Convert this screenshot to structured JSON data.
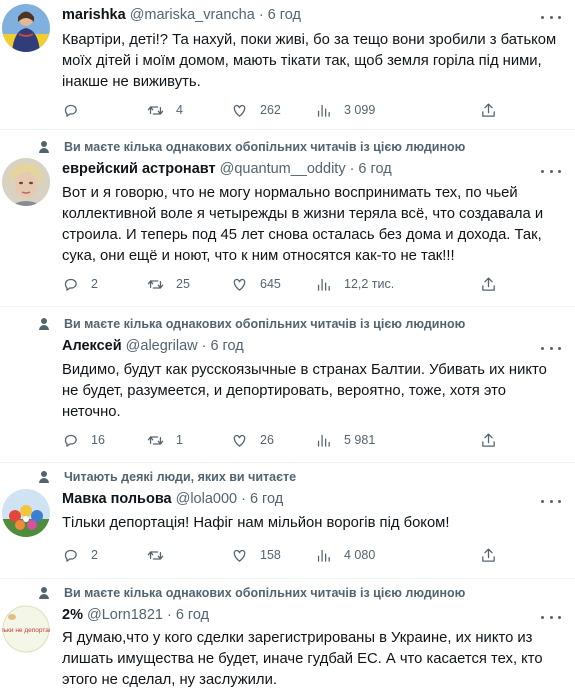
{
  "tweets": [
    {
      "social_context": "",
      "name": "marishka",
      "handle": "@mariska_vrancha",
      "dot": "·",
      "time": "6 год",
      "text": "Квартіри, деті!? Та нахуй, поки живі, бо за тещо вони зробили з батьком моїх дітей і моїм домом, мають тікати так, щоб земля горіла під ними, інакше не виживуть.",
      "replies": "",
      "retweets": "4",
      "likes": "262",
      "views": "3 099"
    },
    {
      "social_context": "Ви маєте кілька однакових обопільних читачів із цією людиною",
      "name": "еврейский астронавт",
      "handle": "@quantum__oddity",
      "dot": "·",
      "time": "6 год",
      "text": "Вот и я говорю, что не могу нормально воспринимать тех, по чьей коллективной воле я четырежды в жизни теряла всё, что создавала и строила. И теперь под 45 лет снова осталась без дома и дохода. Так, сука, они ещё и ноют, что к ним относятся как-то не так!!!",
      "replies": "2",
      "retweets": "25",
      "likes": "645",
      "views": "12,2 тис."
    },
    {
      "social_context": "Ви маєте кілька однакових обопільних читачів із цією людиною",
      "name": "Алексей",
      "handle": "@alegrilaw",
      "dot": "·",
      "time": "6 год",
      "text": "Видимо, будут как русскоязычные в странах Балтии. Убивать их никто не будет, разумеется, и депортировать, вероятно, тоже, хотя это неточно.",
      "replies": "16",
      "retweets": "1",
      "likes": "26",
      "views": "5 981"
    },
    {
      "social_context": "Читають деякі люди, яких ви читаєте",
      "name": "Мавка польова",
      "handle": "@lola000",
      "dot": "·",
      "time": "6 год",
      "text": "Тільки депортація! Нафіг нам мільйон ворогів під боком!",
      "replies": "2",
      "retweets": "",
      "likes": "158",
      "views": "4 080"
    },
    {
      "social_context": "Ви маєте кілька однакових обопільних читачів із цією людиною",
      "name": "2%",
      "handle": "@Lorn1821",
      "dot": "·",
      "time": "6 год",
      "text": "Я думаю,что у кого сделки зарегистрированы в Украине, их никто из лишать имущества не будет, иначе гудбай ЕС. А что касается тех, кто этого не сделал, ну заслужили.",
      "replies": "",
      "retweets": "",
      "likes": "",
      "views": ""
    }
  ],
  "avatars": {
    "t4_badge_text": "Тільки не депортація"
  },
  "icons": {
    "reply": "reply-icon",
    "retweet": "retweet-icon",
    "like": "like-icon",
    "views": "views-icon",
    "share": "share-icon",
    "more": "more-icon",
    "person": "person-icon"
  },
  "colors": {
    "text": "#0f1419",
    "secondary": "#536471",
    "divider": "#eff3f4"
  }
}
